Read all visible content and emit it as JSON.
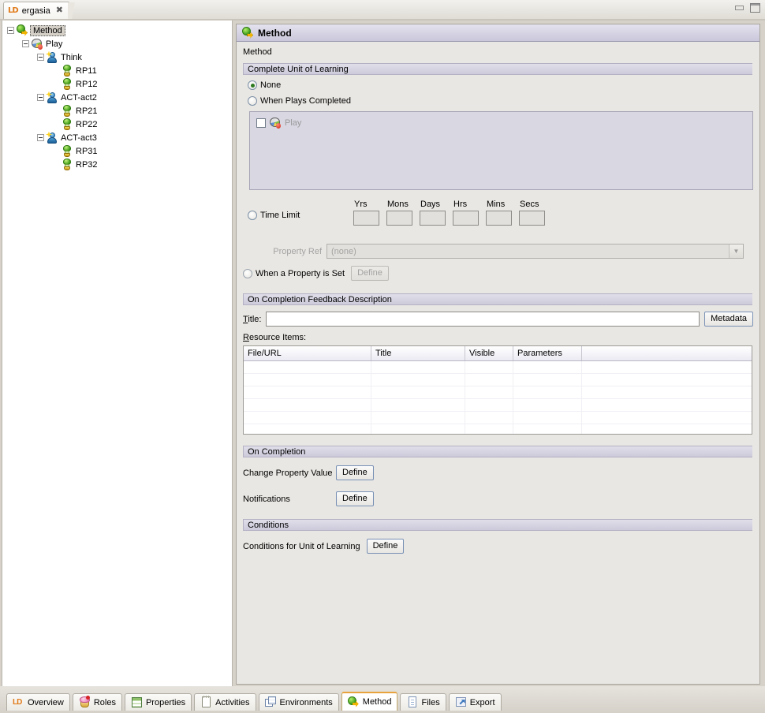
{
  "window": {
    "tab_title": "ergasia",
    "tab_icon": "ld-logo-icon",
    "close_glyph": "✖",
    "minimize_label": "Minimize",
    "maximize_label": "Maximize"
  },
  "tree": {
    "nodes": [
      {
        "label": "Method",
        "icon": "method-icon",
        "depth": 0,
        "expandable": true,
        "selected": true
      },
      {
        "label": "Play",
        "icon": "play-icon",
        "depth": 1,
        "expandable": true,
        "selected": false
      },
      {
        "label": "Think",
        "icon": "act-icon",
        "depth": 2,
        "expandable": true,
        "selected": false
      },
      {
        "label": "RP11",
        "icon": "rp-icon",
        "depth": 3,
        "expandable": false,
        "selected": false
      },
      {
        "label": "RP12",
        "icon": "rp-icon",
        "depth": 3,
        "expandable": false,
        "selected": false
      },
      {
        "label": "ACT-act2",
        "icon": "act-icon",
        "depth": 2,
        "expandable": true,
        "selected": false
      },
      {
        "label": "RP21",
        "icon": "rp-icon",
        "depth": 3,
        "expandable": false,
        "selected": false
      },
      {
        "label": "RP22",
        "icon": "rp-icon",
        "depth": 3,
        "expandable": false,
        "selected": false
      },
      {
        "label": "ACT-act3",
        "icon": "act-icon",
        "depth": 2,
        "expandable": true,
        "selected": false
      },
      {
        "label": "RP31",
        "icon": "rp-icon",
        "depth": 3,
        "expandable": false,
        "selected": false
      },
      {
        "label": "RP32",
        "icon": "rp-icon",
        "depth": 3,
        "expandable": false,
        "selected": false
      }
    ]
  },
  "editor": {
    "header_title": "Method",
    "header_icon": "method-icon",
    "form_caption": "Method",
    "complete_unit": {
      "section_title": "Complete Unit of Learning",
      "option_none": "None",
      "option_when_plays_completed": "When Plays Completed",
      "option_time_limit": "Time Limit",
      "option_when_property_set": "When a Property is Set",
      "selected_option": "None",
      "plays_list": [
        {
          "label": "Play",
          "icon": "play-icon",
          "checked": false,
          "enabled": false
        }
      ],
      "time_fields": [
        {
          "label": "Yrs",
          "value": ""
        },
        {
          "label": "Mons",
          "value": ""
        },
        {
          "label": "Days",
          "value": ""
        },
        {
          "label": "Hrs",
          "value": ""
        },
        {
          "label": "Mins",
          "value": ""
        },
        {
          "label": "Secs",
          "value": ""
        }
      ],
      "property_ref_label": "Property Ref",
      "property_ref_value": "(none)",
      "property_define_label": "Define"
    },
    "feedback": {
      "section_title": "On Completion Feedback Description",
      "title_label": "Title:",
      "title_value": "",
      "metadata_button": "Metadata",
      "resource_items_label": "Resource Items:",
      "table": {
        "columns": [
          "File/URL",
          "Title",
          "Visible",
          "Parameters",
          ""
        ],
        "rows": []
      }
    },
    "on_completion": {
      "section_title": "On Completion",
      "change_property_label": "Change Property Value",
      "change_property_button": "Define",
      "notifications_label": "Notifications",
      "notifications_button": "Define"
    },
    "conditions": {
      "section_title": "Conditions",
      "conditions_label": "Conditions for Unit of Learning",
      "conditions_button": "Define"
    }
  },
  "bottom_tabs": [
    {
      "label": "Overview",
      "icon": "ld-logo-icon",
      "active": false
    },
    {
      "label": "Roles",
      "icon": "cupcake-icon",
      "active": false
    },
    {
      "label": "Properties",
      "icon": "grid-icon",
      "active": false
    },
    {
      "label": "Activities",
      "icon": "notepad-icon",
      "active": false
    },
    {
      "label": "Environments",
      "icon": "windows-icon",
      "active": false
    },
    {
      "label": "Method",
      "icon": "method-icon",
      "active": true
    },
    {
      "label": "Files",
      "icon": "document-icon",
      "active": false
    },
    {
      "label": "Export",
      "icon": "export-arrow-icon",
      "active": false
    }
  ],
  "colors": {
    "accent": "#e8a33d",
    "section_header": "#cdcbdb",
    "panel_bg": "#e9e7e3",
    "brand_orange": "#e07b1a"
  }
}
